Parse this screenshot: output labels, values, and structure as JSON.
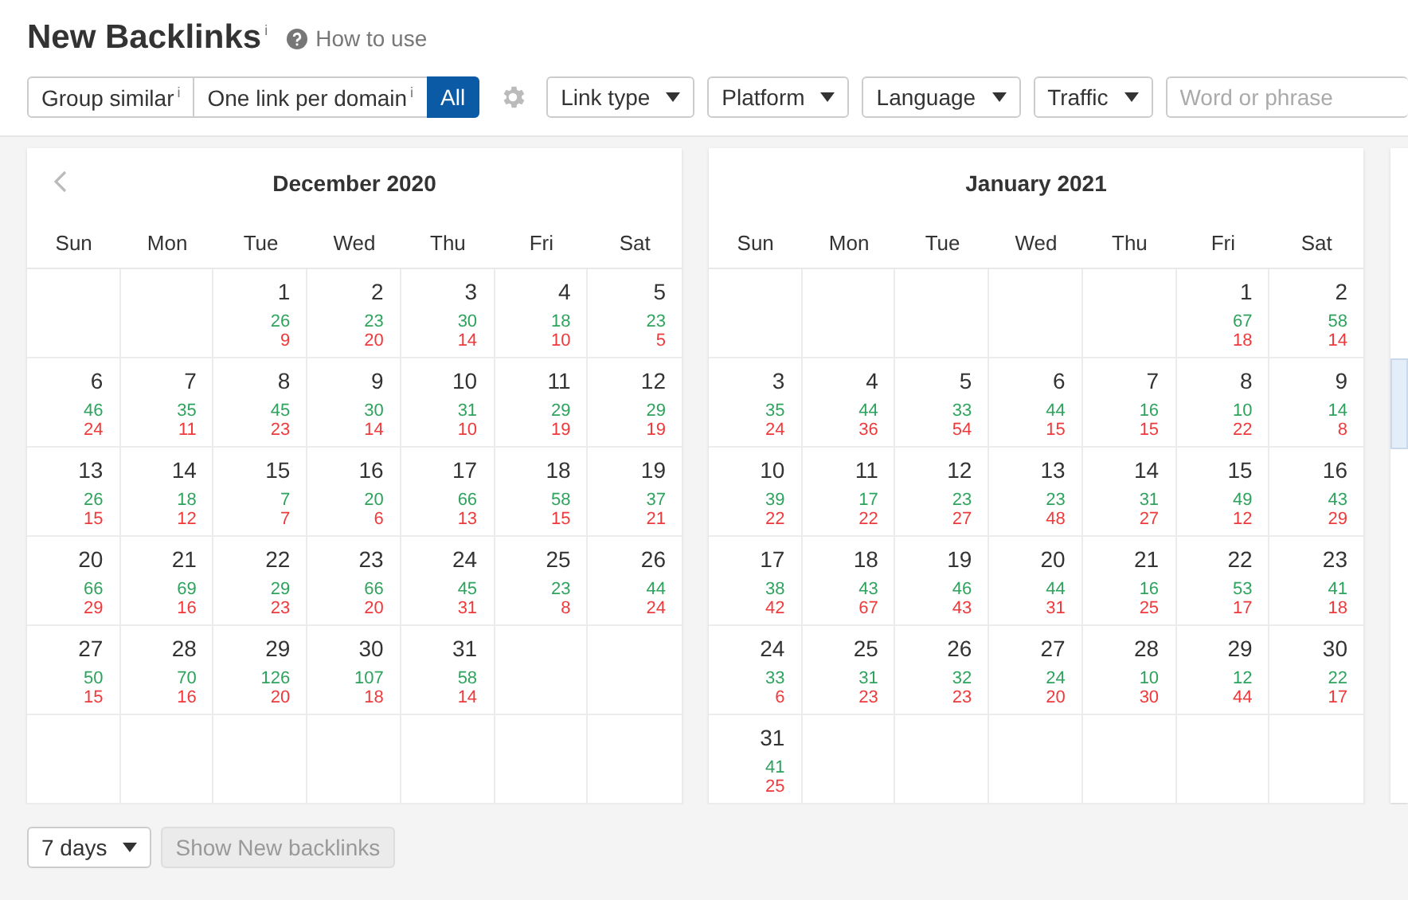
{
  "page": {
    "title": "New Backlinks",
    "title_info": "i",
    "help_link": "How to use"
  },
  "toolbar": {
    "modes": [
      {
        "label": "Group similar",
        "info": "i",
        "selected": false
      },
      {
        "label": "One link per domain",
        "info": "i",
        "selected": false
      },
      {
        "label": "All",
        "selected": true
      }
    ],
    "filters": [
      "Link type",
      "Platform",
      "Language",
      "Traffic"
    ],
    "search": {
      "placeholder": "Word or phrase"
    }
  },
  "calendars": [
    {
      "title": "December 2020",
      "prev_arrow": true,
      "weekdays": [
        "Sun",
        "Mon",
        "Tue",
        "Wed",
        "Thu",
        "Fri",
        "Sat"
      ],
      "weeks": [
        [
          {
            "kind": "blank"
          },
          {
            "kind": "blank"
          },
          {
            "kind": "day",
            "day": "1",
            "new": "26",
            "lost": "9"
          },
          {
            "kind": "day",
            "day": "2",
            "new": "23",
            "lost": "20"
          },
          {
            "kind": "day",
            "day": "3",
            "new": "30",
            "lost": "14"
          },
          {
            "kind": "day",
            "day": "4",
            "new": "18",
            "lost": "10"
          },
          {
            "kind": "day",
            "day": "5",
            "new": "23",
            "lost": "5"
          }
        ],
        [
          {
            "kind": "day",
            "day": "6",
            "new": "46",
            "lost": "24"
          },
          {
            "kind": "day",
            "day": "7",
            "new": "35",
            "lost": "11"
          },
          {
            "kind": "day",
            "day": "8",
            "new": "45",
            "lost": "23"
          },
          {
            "kind": "day",
            "day": "9",
            "new": "30",
            "lost": "14"
          },
          {
            "kind": "day",
            "day": "10",
            "new": "31",
            "lost": "10"
          },
          {
            "kind": "day",
            "day": "11",
            "new": "29",
            "lost": "19"
          },
          {
            "kind": "day",
            "day": "12",
            "new": "29",
            "lost": "19"
          }
        ],
        [
          {
            "kind": "day",
            "day": "13",
            "new": "26",
            "lost": "15"
          },
          {
            "kind": "day",
            "day": "14",
            "new": "18",
            "lost": "12"
          },
          {
            "kind": "day",
            "day": "15",
            "new": "7",
            "lost": "7"
          },
          {
            "kind": "day",
            "day": "16",
            "new": "20",
            "lost": "6"
          },
          {
            "kind": "day",
            "day": "17",
            "new": "66",
            "lost": "13"
          },
          {
            "kind": "day",
            "day": "18",
            "new": "58",
            "lost": "15"
          },
          {
            "kind": "day",
            "day": "19",
            "new": "37",
            "lost": "21"
          }
        ],
        [
          {
            "kind": "day",
            "day": "20",
            "new": "66",
            "lost": "29"
          },
          {
            "kind": "day",
            "day": "21",
            "new": "69",
            "lost": "16"
          },
          {
            "kind": "day",
            "day": "22",
            "new": "29",
            "lost": "23"
          },
          {
            "kind": "day",
            "day": "23",
            "new": "66",
            "lost": "20"
          },
          {
            "kind": "day",
            "day": "24",
            "new": "45",
            "lost": "31"
          },
          {
            "kind": "day",
            "day": "25",
            "new": "23",
            "lost": "8"
          },
          {
            "kind": "day",
            "day": "26",
            "new": "44",
            "lost": "24"
          }
        ],
        [
          {
            "kind": "day",
            "day": "27",
            "new": "50",
            "lost": "15"
          },
          {
            "kind": "day",
            "day": "28",
            "new": "70",
            "lost": "16"
          },
          {
            "kind": "day",
            "day": "29",
            "new": "126",
            "lost": "20"
          },
          {
            "kind": "day",
            "day": "30",
            "new": "107",
            "lost": "18"
          },
          {
            "kind": "day",
            "day": "31",
            "new": "58",
            "lost": "14"
          },
          {
            "kind": "blank"
          },
          {
            "kind": "blank"
          }
        ]
      ]
    },
    {
      "title": "January 2021",
      "weekdays": [
        "Sun",
        "Mon",
        "Tue",
        "Wed",
        "Thu",
        "Fri",
        "Sat"
      ],
      "weeks": [
        [
          {
            "kind": "blank"
          },
          {
            "kind": "blank"
          },
          {
            "kind": "blank"
          },
          {
            "kind": "blank"
          },
          {
            "kind": "blank"
          },
          {
            "kind": "day",
            "day": "1",
            "new": "67",
            "lost": "18"
          },
          {
            "kind": "day",
            "day": "2",
            "new": "58",
            "lost": "14"
          }
        ],
        [
          {
            "kind": "day",
            "day": "3",
            "new": "35",
            "lost": "24"
          },
          {
            "kind": "day",
            "day": "4",
            "new": "44",
            "lost": "36"
          },
          {
            "kind": "day",
            "day": "5",
            "new": "33",
            "lost": "54"
          },
          {
            "kind": "day",
            "day": "6",
            "new": "44",
            "lost": "15"
          },
          {
            "kind": "day",
            "day": "7",
            "new": "16",
            "lost": "15"
          },
          {
            "kind": "day",
            "day": "8",
            "new": "10",
            "lost": "22"
          },
          {
            "kind": "day",
            "day": "9",
            "new": "14",
            "lost": "8"
          }
        ],
        [
          {
            "kind": "day",
            "day": "10",
            "new": "39",
            "lost": "22"
          },
          {
            "kind": "day",
            "day": "11",
            "new": "17",
            "lost": "22"
          },
          {
            "kind": "day",
            "day": "12",
            "new": "23",
            "lost": "27"
          },
          {
            "kind": "day",
            "day": "13",
            "new": "23",
            "lost": "48"
          },
          {
            "kind": "day",
            "day": "14",
            "new": "31",
            "lost": "27"
          },
          {
            "kind": "day",
            "day": "15",
            "new": "49",
            "lost": "12"
          },
          {
            "kind": "day",
            "day": "16",
            "new": "43",
            "lost": "29"
          }
        ],
        [
          {
            "kind": "day",
            "day": "17",
            "new": "38",
            "lost": "42"
          },
          {
            "kind": "day",
            "day": "18",
            "new": "43",
            "lost": "67"
          },
          {
            "kind": "day",
            "day": "19",
            "new": "46",
            "lost": "43"
          },
          {
            "kind": "day",
            "day": "20",
            "new": "44",
            "lost": "31"
          },
          {
            "kind": "day",
            "day": "21",
            "new": "16",
            "lost": "25"
          },
          {
            "kind": "day",
            "day": "22",
            "new": "53",
            "lost": "17"
          },
          {
            "kind": "day",
            "day": "23",
            "new": "41",
            "lost": "18"
          }
        ],
        [
          {
            "kind": "day",
            "day": "24",
            "new": "33",
            "lost": "6"
          },
          {
            "kind": "day",
            "day": "25",
            "new": "31",
            "lost": "23"
          },
          {
            "kind": "day",
            "day": "26",
            "new": "32",
            "lost": "23"
          },
          {
            "kind": "day",
            "day": "27",
            "new": "24",
            "lost": "20"
          },
          {
            "kind": "day",
            "day": "28",
            "new": "10",
            "lost": "30"
          },
          {
            "kind": "day",
            "day": "29",
            "new": "12",
            "lost": "44"
          },
          {
            "kind": "day",
            "day": "30",
            "new": "22",
            "lost": "17"
          }
        ],
        [
          {
            "kind": "day",
            "day": "31",
            "new": "41",
            "lost": "25"
          },
          {
            "kind": "blank"
          },
          {
            "kind": "blank"
          },
          {
            "kind": "blank"
          },
          {
            "kind": "blank"
          },
          {
            "kind": "blank"
          },
          {
            "kind": "blank"
          }
        ]
      ]
    }
  ],
  "footer": {
    "period": "7 days",
    "show_button": {
      "label": "Show New backlinks",
      "disabled": true
    }
  }
}
